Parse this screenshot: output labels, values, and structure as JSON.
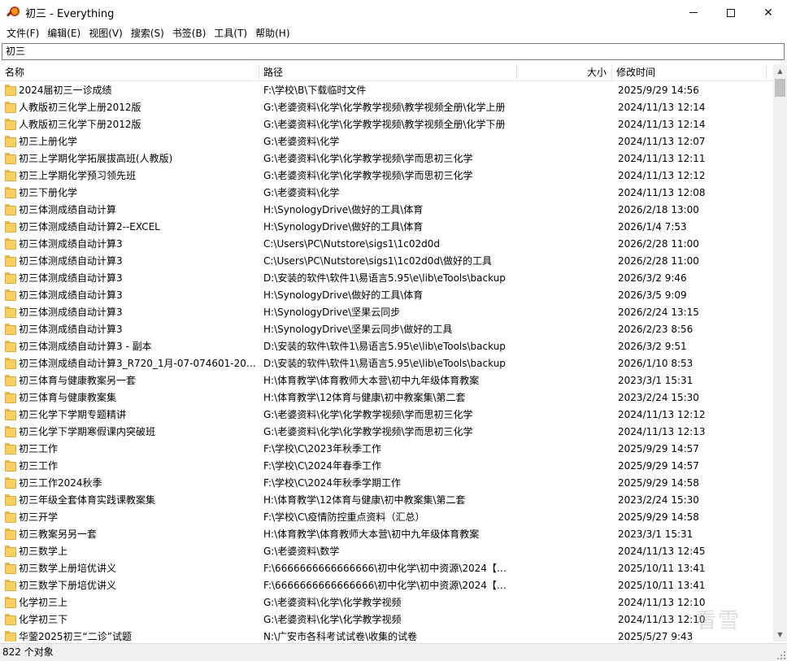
{
  "window": {
    "title": "初三 - Everything",
    "controls": {
      "minimize": "minimize-icon",
      "maximize": "maximize-icon",
      "close": "✕"
    }
  },
  "menu": [
    "文件(F)",
    "编辑(E)",
    "视图(V)",
    "搜索(S)",
    "书签(B)",
    "工具(T)",
    "帮助(H)"
  ],
  "search": {
    "value": "初三"
  },
  "columns": {
    "name": "名称",
    "path": "路径",
    "size": "大小",
    "modified": "修改时间"
  },
  "rows": [
    {
      "name": "2024届初三一诊成绩",
      "path": "F:\\学校\\B\\下载临时文件",
      "modified": "2025/9/29 14:56"
    },
    {
      "name": "人教版初三化学上册2012版",
      "path": "G:\\老婆资料\\化学\\化学教学视频\\教学视频全册\\化学上册",
      "modified": "2024/11/13 12:14"
    },
    {
      "name": "人教版初三化学下册2012版",
      "path": "G:\\老婆资料\\化学\\化学教学视频\\教学视频全册\\化学下册",
      "modified": "2024/11/13 12:14"
    },
    {
      "name": "初三上册化学",
      "path": "G:\\老婆资料\\化学",
      "modified": "2024/11/13 12:07"
    },
    {
      "name": "初三上学期化学拓展拔高班(人教版)",
      "path": "G:\\老婆资料\\化学\\化学教学视频\\学而思初三化学",
      "modified": "2024/11/13 12:11"
    },
    {
      "name": "初三上学期化学预习领先班",
      "path": "G:\\老婆资料\\化学\\化学教学视频\\学而思初三化学",
      "modified": "2024/11/13 12:12"
    },
    {
      "name": "初三下册化学",
      "path": "G:\\老婆资料\\化学",
      "modified": "2024/11/13 12:08"
    },
    {
      "name": "初三体测成绩自动计算",
      "path": "H:\\SynologyDrive\\做好的工具\\体育",
      "modified": "2026/2/18 13:00"
    },
    {
      "name": "初三体测成绩自动计算2--EXCEL",
      "path": "H:\\SynologyDrive\\做好的工具\\体育",
      "modified": "2026/1/4 7:53"
    },
    {
      "name": "初三体测成绩自动计算3",
      "path": "C:\\Users\\PC\\Nutstore\\sigs1\\1c02d0d",
      "modified": "2026/2/28 11:00"
    },
    {
      "name": "初三体测成绩自动计算3",
      "path": "C:\\Users\\PC\\Nutstore\\sigs1\\1c02d0d\\做好的工具",
      "modified": "2026/2/28 11:00"
    },
    {
      "name": "初三体测成绩自动计算3",
      "path": "D:\\安装的软件\\软件1\\易语言5.95\\e\\lib\\eTools\\backup",
      "modified": "2026/3/2 9:46"
    },
    {
      "name": "初三体测成绩自动计算3",
      "path": "H:\\SynologyDrive\\做好的工具\\体育",
      "modified": "2026/3/5 9:09"
    },
    {
      "name": "初三体测成绩自动计算3",
      "path": "H:\\SynologyDrive\\坚果云同步",
      "modified": "2026/2/24 13:15"
    },
    {
      "name": "初三体测成绩自动计算3",
      "path": "H:\\SynologyDrive\\坚果云同步\\做好的工具",
      "modified": "2026/2/23 8:56"
    },
    {
      "name": "初三体测成绩自动计算3 - 副本",
      "path": "D:\\安装的软件\\软件1\\易语言5.95\\e\\lib\\eTools\\backup",
      "modified": "2026/3/2 9:51"
    },
    {
      "name": "初三体测成绩自动计算3_R720_1月-07-074601-2026...",
      "path": "D:\\安装的软件\\软件1\\易语言5.95\\e\\lib\\eTools\\backup",
      "modified": "2026/1/10 8:53"
    },
    {
      "name": "初三体育与健康教案另一套",
      "path": "H:\\体育教学\\体育教师大本营\\初中九年级体育教案",
      "modified": "2023/3/1 15:31"
    },
    {
      "name": "初三体育与健康教案集",
      "path": "H:\\体育教学\\12体育与健康\\初中教案集\\第二套",
      "modified": "2023/2/24 15:30"
    },
    {
      "name": "初三化学下学期专题精讲",
      "path": "G:\\老婆资料\\化学\\化学教学视频\\学而思初三化学",
      "modified": "2024/11/13 12:12"
    },
    {
      "name": "初三化学下学期寒假课内突破班",
      "path": "G:\\老婆资料\\化学\\化学教学视频\\学而思初三化学",
      "modified": "2024/11/13 12:13"
    },
    {
      "name": "初三工作",
      "path": "F:\\学校\\C\\2023年秋季工作",
      "modified": "2025/9/29 14:57"
    },
    {
      "name": "初三工作",
      "path": "F:\\学校\\C\\2024年春季工作",
      "modified": "2025/9/29 14:57"
    },
    {
      "name": "初三工作2024秋季",
      "path": "F:\\学校\\C\\2024年秋季学期工作",
      "modified": "2025/9/29 14:58"
    },
    {
      "name": "初三年级全套体育实践课教案集",
      "path": "H:\\体育教学\\12体育与健康\\初中教案集\\第二套",
      "modified": "2023/2/24 15:30"
    },
    {
      "name": "初三开学",
      "path": "F:\\学校\\C\\疫情防控重点资料（汇总）",
      "modified": "2025/9/29 14:58"
    },
    {
      "name": "初三教案另另一套",
      "path": "H:\\体育教学\\体育教师大本营\\初中九年级体育教案",
      "modified": "2023/3/1 15:31"
    },
    {
      "name": "初三数学上",
      "path": "G:\\老婆资料\\数学",
      "modified": "2024/11/13 12:45"
    },
    {
      "name": "初三数学上册培优讲义",
      "path": "F:\\6666666666666666\\初中化学\\初中资源\\2024【学...",
      "modified": "2025/10/11 13:41"
    },
    {
      "name": "初三数学下册培优讲义",
      "path": "F:\\6666666666666666\\初中化学\\初中资源\\2024【学...",
      "modified": "2025/10/11 13:41"
    },
    {
      "name": "化学初三上",
      "path": "G:\\老婆资料\\化学\\化学教学视频",
      "modified": "2024/11/13 12:10"
    },
    {
      "name": "化学初三下",
      "path": "G:\\老婆资料\\化学\\化学教学视频",
      "modified": "2024/11/13 12:10"
    },
    {
      "name": "华蓥2025初三“二诊”试题",
      "path": "N:\\广安市各科考试试卷\\收集的试卷",
      "modified": "2025/5/27 9:43"
    }
  ],
  "status": {
    "count": "822 个对象"
  },
  "watermark": "看雪"
}
